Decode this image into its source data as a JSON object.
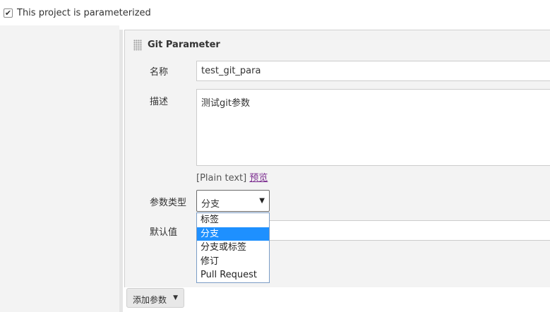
{
  "header": {
    "checkbox_checked": true,
    "label": "This project is parameterized"
  },
  "panel": {
    "title": "Git Parameter",
    "name": {
      "label": "名称",
      "value": "test_git_para"
    },
    "description": {
      "label": "描述",
      "value": "测试git参数"
    },
    "format": {
      "plain": "[Plain text]",
      "preview": "预览"
    },
    "param_type": {
      "label": "参数类型",
      "selected": "分支",
      "options": [
        "标签",
        "分支",
        "分支或标签",
        "修订",
        "Pull Request"
      ],
      "highlighted_index": 1
    },
    "default_value": {
      "label": "默认值",
      "value": ""
    }
  },
  "footer": {
    "add_param": "添加参数"
  },
  "icons": {
    "checkbox": "check-icon",
    "drag": "drag-handle-icon",
    "select_caret": "caret-down-icon",
    "add_caret": "caret-down-icon"
  },
  "colors": {
    "highlight": "#1e90ff",
    "link": "#7b2c8f"
  }
}
